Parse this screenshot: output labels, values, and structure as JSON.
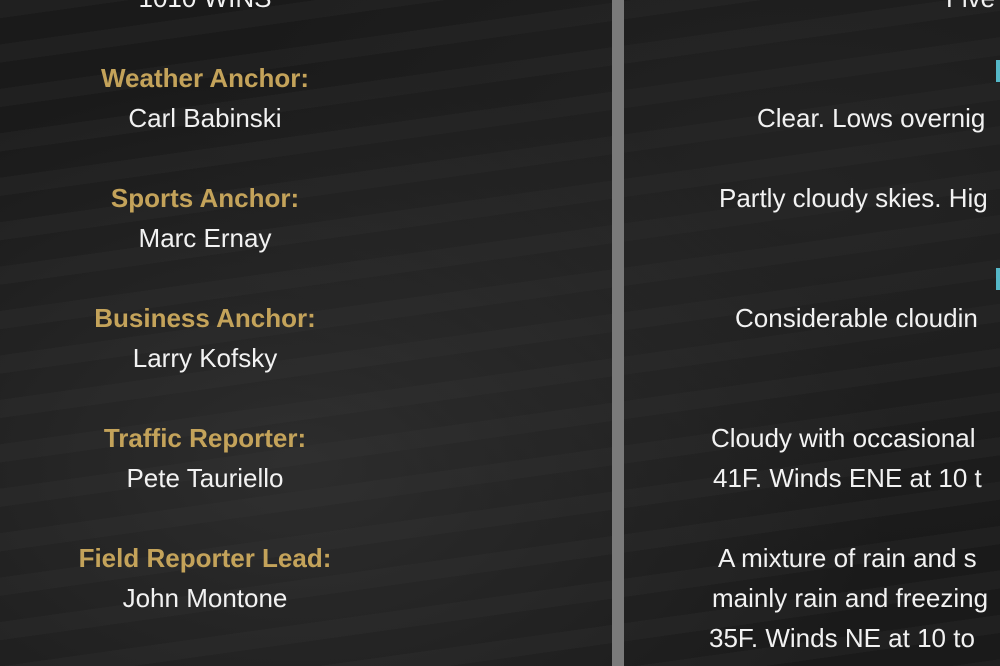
{
  "station": "1010 WINS",
  "staff": [
    {
      "role": "Weather Anchor:",
      "name": "Carl Babinski"
    },
    {
      "role": "Sports Anchor:",
      "name": "Marc Ernay"
    },
    {
      "role": "Business Anchor:",
      "name": "Larry Kofsky"
    },
    {
      "role": "Traffic Reporter:",
      "name": "Pete Tauriello"
    },
    {
      "role": "Field Reporter Lead:",
      "name": "John Montone"
    }
  ],
  "forecast": {
    "header": "Five",
    "lines": [
      "Clear. Lows overnig",
      "Partly cloudy skies. Hig",
      "Considerable cloudin",
      "Cloudy with occasional",
      "41F. Winds ENE at 10 t",
      "A mixture of rain and s",
      "mainly rain and freezing",
      "35F. Winds NE at 10 to"
    ]
  },
  "colors": {
    "role": "#c4a35a",
    "text": "#f2f2f2",
    "divider": "#7a7a7a",
    "accent": "#55b8c8"
  }
}
